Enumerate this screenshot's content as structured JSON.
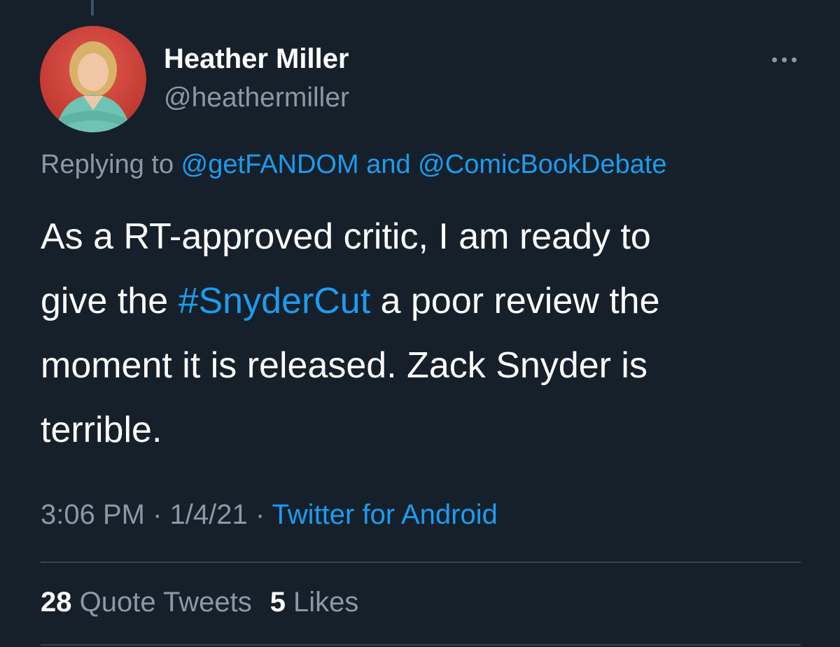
{
  "author": {
    "display_name": "Heather Miller",
    "handle": "@heathermiller",
    "avatar_alt": "profile photo"
  },
  "reply_context": {
    "prefix": "Replying to ",
    "mention_1": "@getFANDOM",
    "conjunction": " and ",
    "mention_2": "@ComicBookDebate"
  },
  "tweet": {
    "line_1": "As a RT-approved critic, I am ready to",
    "line_2_before": "give the ",
    "hashtag": "#SnyderCut",
    "line_2_after": " a poor review the",
    "line_3": "moment it is released. Zack Snyder is",
    "line_4": "terrible."
  },
  "meta": {
    "time": "3:06 PM",
    "sep_1": " · ",
    "date": "1/4/21",
    "sep_2": " · ",
    "source": "Twitter for Android"
  },
  "stats": {
    "quote_count": "28",
    "quote_label": " Quote Tweets",
    "like_count": "5",
    "like_label": " Likes"
  },
  "icons": {
    "more": "more-horizontal-icon"
  },
  "colors": {
    "background": "#15202b",
    "link": "#1d9bf0",
    "secondary_text": "#8b98a5",
    "divider": "#38444d"
  }
}
